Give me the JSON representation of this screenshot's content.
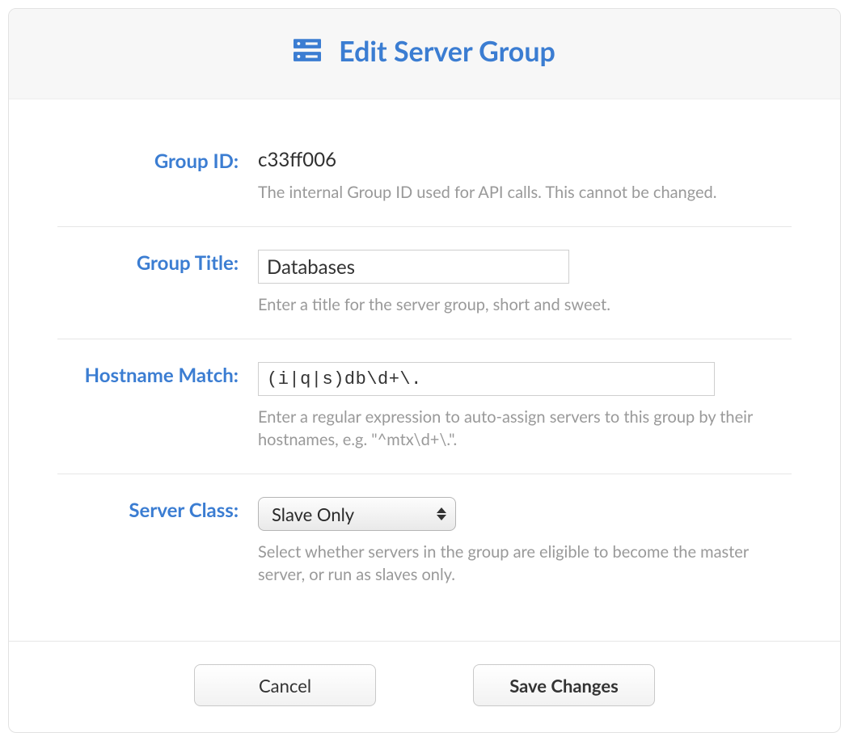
{
  "header": {
    "title": "Edit Server Group"
  },
  "fields": {
    "group_id": {
      "label": "Group ID:",
      "value": "c33ff006",
      "help": "The internal Group ID used for API calls. This cannot be changed."
    },
    "group_title": {
      "label": "Group Title:",
      "value": "Databases",
      "help": "Enter a title for the server group, short and sweet."
    },
    "hostname_match": {
      "label": "Hostname Match:",
      "value": "(i|q|s)db\\d+\\.",
      "help": "Enter a regular expression to auto-assign servers to this group by their hostnames, e.g. \"^mtx\\d+\\.\"."
    },
    "server_class": {
      "label": "Server Class:",
      "value": "Slave Only",
      "help": "Select whether servers in the group are eligible to become the master server, or run as slaves only."
    }
  },
  "buttons": {
    "cancel": "Cancel",
    "save": "Save Changes"
  }
}
